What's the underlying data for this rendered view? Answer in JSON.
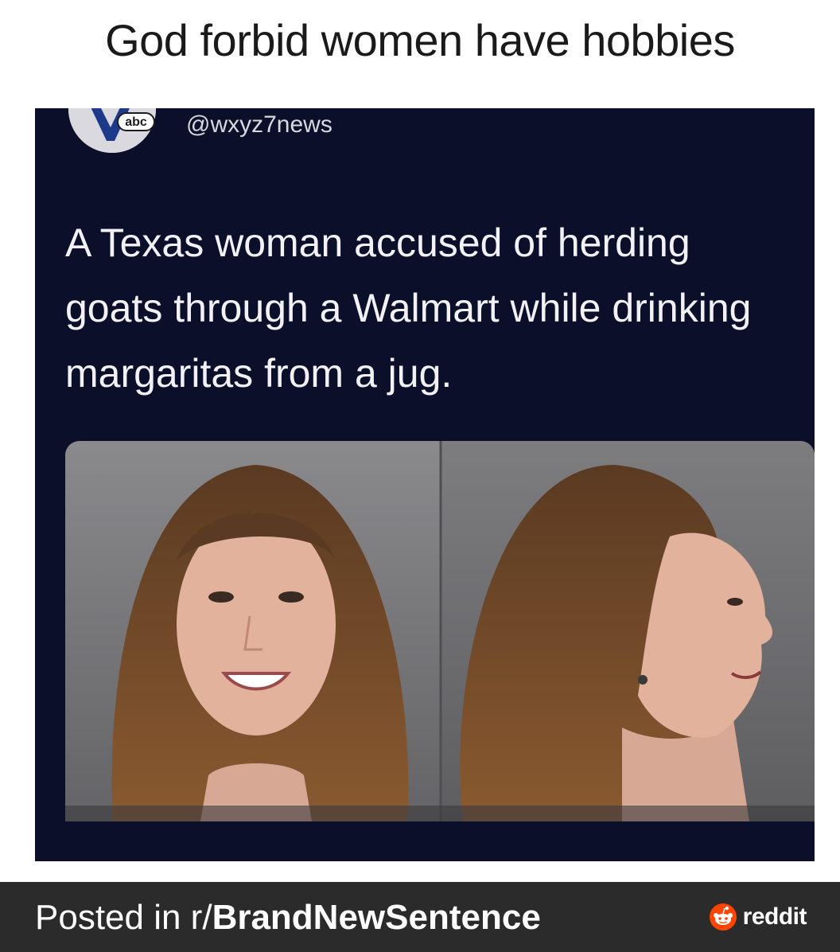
{
  "caption": "God forbid women have hobbies",
  "tweet": {
    "logo_text": "abc",
    "handle": "@wxyz7news",
    "headline": "A Texas woman accused of herding goats through a Walmart while drinking margaritas from a jug."
  },
  "footer": {
    "posted_prefix": "Posted in r/",
    "subreddit": "BrandNewSentence",
    "brand": "reddit",
    "brand_color": "#ff4500"
  },
  "icons": {
    "news_logo": "abc-news-logo-icon",
    "reddit_logo": "reddit-snoo-icon"
  }
}
